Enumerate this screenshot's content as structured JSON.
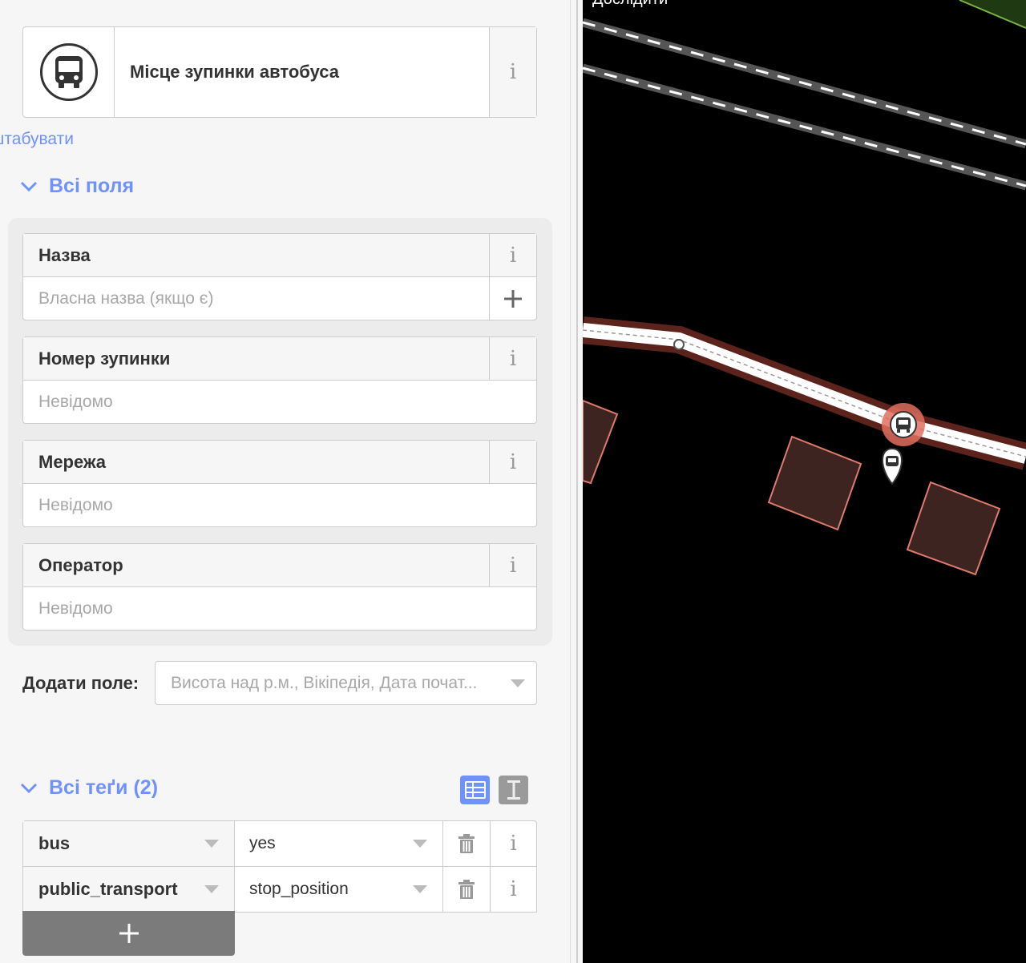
{
  "preset": {
    "name": "Місце зупинки автобуса",
    "icon": "bus-icon",
    "zoom_link": "Масштабувати"
  },
  "all_fields": {
    "title": "Всі поля",
    "fields": [
      {
        "label": "Назва",
        "placeholder": "Власна назва (якщо є)"
      },
      {
        "label": "Номер зупинки",
        "placeholder": "Невідомо"
      },
      {
        "label": "Мережа",
        "placeholder": "Невідомо"
      },
      {
        "label": "Оператор",
        "placeholder": "Невідомо"
      }
    ],
    "add_field": {
      "label": "Додати поле:",
      "placeholder": "Висота над р.м., Вікіпедія, Дата почат..."
    }
  },
  "all_tags": {
    "title": "Всі теґи (2)",
    "tags": [
      {
        "key": "bus",
        "value": "yes"
      },
      {
        "key": "public_transport",
        "value": "stop_position"
      }
    ]
  },
  "map": {
    "label": "Дослідити"
  },
  "colors": {
    "accent": "#7092ff",
    "map_background": "#000000",
    "selected_highlight": "#e06e5f"
  }
}
